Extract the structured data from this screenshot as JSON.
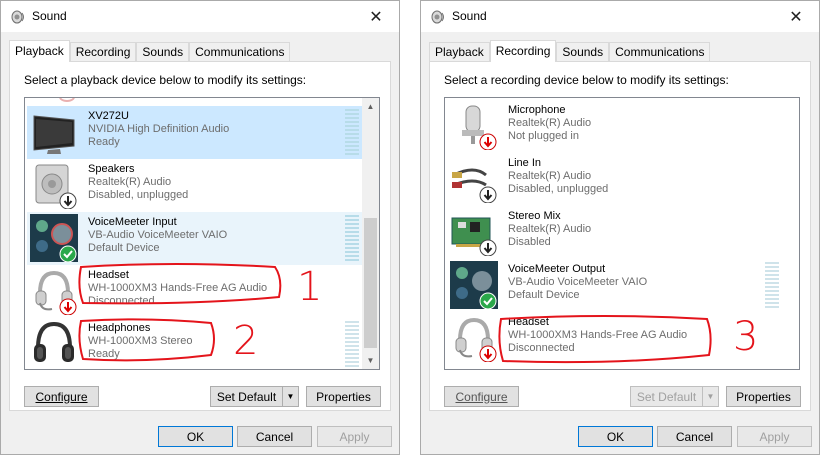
{
  "left": {
    "title": "Sound",
    "tabs": [
      "Playback",
      "Recording",
      "Sounds",
      "Communications"
    ],
    "active_tab": 0,
    "instruction": "Select a playback device below to modify its settings:",
    "devices": [
      {
        "name": "XV272U",
        "line1": "NVIDIA High Definition Audio",
        "line2": "Ready",
        "icon": "monitor-icon",
        "status_icon": ""
      },
      {
        "name": "Speakers",
        "line1": "Realtek(R) Audio",
        "line2": "Disabled, unplugged",
        "icon": "speaker-icon",
        "status_icon": "down-arrow-badge-icon"
      },
      {
        "name": "VoiceMeeter Input",
        "line1": "VB-Audio VoiceMeeter VAIO",
        "line2": "Default Device",
        "icon": "voicemeeter-icon",
        "status_icon": "green-check-badge-icon"
      },
      {
        "name": "Headset",
        "line1": "WH-1000XM3 Hands-Free AG Audio",
        "line2": "Disconnected",
        "icon": "headset-icon",
        "status_icon": "red-down-arrow-badge-icon"
      },
      {
        "name": "Headphones",
        "line1": "WH-1000XM3 Stereo",
        "line2": "Ready",
        "icon": "headphones-icon",
        "status_icon": ""
      }
    ],
    "buttons": {
      "configure": "Configure",
      "set_default": "Set Default",
      "properties": "Properties",
      "ok": "OK",
      "cancel": "Cancel",
      "apply": "Apply"
    },
    "annotations": [
      "1",
      "2"
    ]
  },
  "right": {
    "title": "Sound",
    "tabs": [
      "Playback",
      "Recording",
      "Sounds",
      "Communications"
    ],
    "active_tab": 1,
    "instruction": "Select a recording device below to modify its settings:",
    "devices": [
      {
        "name": "Microphone",
        "line1": "Realtek(R) Audio",
        "line2": "Not plugged in",
        "icon": "microphone-icon",
        "status_icon": "red-down-arrow-badge-icon"
      },
      {
        "name": "Line In",
        "line1": "Realtek(R) Audio",
        "line2": "Disabled, unplugged",
        "icon": "line-in-cable-icon",
        "status_icon": "down-arrow-badge-icon"
      },
      {
        "name": "Stereo Mix",
        "line1": "Realtek(R) Audio",
        "line2": "Disabled",
        "icon": "circuit-board-icon",
        "status_icon": "down-arrow-badge-icon"
      },
      {
        "name": "VoiceMeeter Output",
        "line1": "VB-Audio VoiceMeeter VAIO",
        "line2": "Default Device",
        "icon": "voicemeeter-icon",
        "status_icon": "green-check-badge-icon"
      },
      {
        "name": "Headset",
        "line1": "WH-1000XM3 Hands-Free AG Audio",
        "line2": "Disconnected",
        "icon": "headset-icon",
        "status_icon": "red-down-arrow-badge-icon"
      }
    ],
    "buttons": {
      "configure": "Configure",
      "set_default": "Set Default",
      "properties": "Properties",
      "ok": "OK",
      "cancel": "Cancel",
      "apply": "Apply"
    },
    "annotations": [
      "3"
    ]
  },
  "colors": {
    "selection": "#cce8ff",
    "annotation": "#e4141b",
    "focus": "#0078d7"
  }
}
